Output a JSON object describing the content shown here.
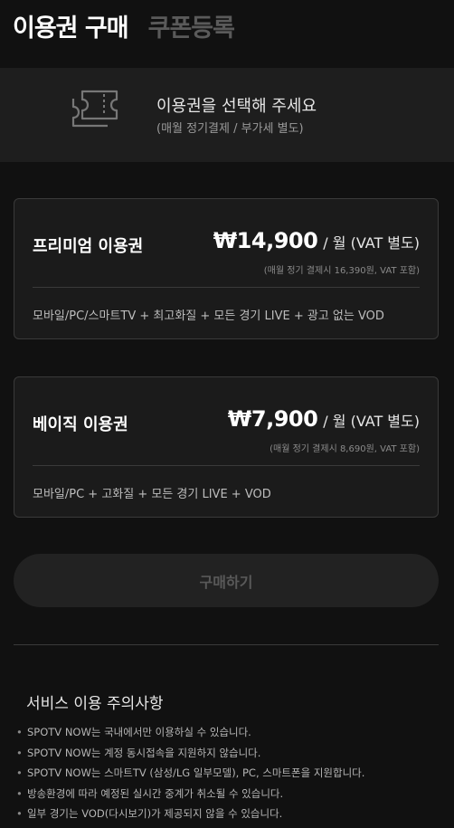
{
  "tabs": [
    {
      "label": "이용권 구매"
    },
    {
      "label": "쿠폰등록"
    }
  ],
  "banner": {
    "icon": "ticket-icon",
    "title": "이용권을 선택해 주세요",
    "subtitle": "(매월 정기결제 / 부가세 별도)"
  },
  "plans": [
    {
      "name": "프리미엄 이용권",
      "price": "₩14,900",
      "unit": "/ 월 (VAT 별도)",
      "note": "(매월 정기 결제시 16,390원, VAT 포함)",
      "features": "모바일/PC/스마트TV + 최고화질 + 모든 경기 LIVE + 광고 없는 VOD"
    },
    {
      "name": "베이직 이용권",
      "price": "₩7,900",
      "unit": "/ 월 (VAT 별도)",
      "note": "(매월 정기 결제시 8,690원, VAT 포함)",
      "features": "모바일/PC + 고화질 + 모든 경기 LIVE + VOD"
    }
  ],
  "buy_button": {
    "label": "구매하기"
  },
  "notice": {
    "title": "서비스 이용 주의사항",
    "bullet": "•",
    "items": [
      "SPOTV NOW는 국내에서만 이용하실 수 있습니다.",
      "SPOTV NOW는 계정 동시접속을 지원하지 않습니다.",
      "SPOTV NOW는 스마트TV (삼성/LG 일부모델), PC, 스마트폰을 지원합니다.",
      "방송환경에 따라 예정된 실시간 중계가 취소될 수 있습니다.",
      "일부 경기는 VOD(다시보기)가 제공되지 않을 수 있습니다."
    ]
  },
  "colors": {
    "background": "#111111",
    "banner": "#1e1e1e",
    "card": "#1b1b1b",
    "border": "#3a3a3a",
    "inactive_tab": "#5a5a5a"
  }
}
